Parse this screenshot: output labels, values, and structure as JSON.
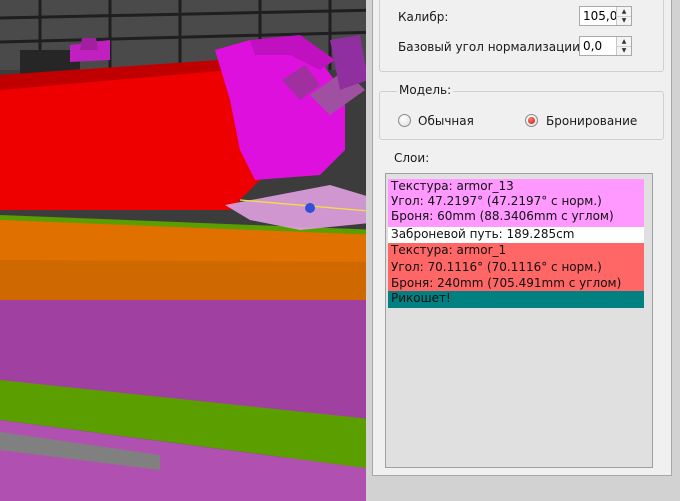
{
  "settings": {
    "caliber_label": "Калибр:",
    "caliber_value": "105,0",
    "normalization_label": "Базовый угол нормализации:",
    "normalization_value": "0,0"
  },
  "model": {
    "title": "Модель:",
    "options": [
      {
        "label": "Обычная",
        "selected": false
      },
      {
        "label": "Бронирование",
        "selected": true
      }
    ]
  },
  "layers": {
    "title": "Слои:",
    "lines": [
      {
        "text": "Текстура: armor_13",
        "color": "#ff99ff"
      },
      {
        "text": "Угол: 47.2197° (47.2197° с норм.)",
        "color": "#ff99ff"
      },
      {
        "text": "Броня: 60mm (88.3406mm с углом)",
        "color": "#ff99ff"
      },
      {
        "text": "Заброневой путь: 189.285cm",
        "color": "#ffffff"
      },
      {
        "text": "Текстура: armor_1",
        "color": "#ff6666"
      },
      {
        "text": "Угол: 70.1116° (70.1116° с норм.)",
        "color": "#ff6666"
      },
      {
        "text": "Броня: 240mm (705.491mm с углом)",
        "color": "#ff6666"
      },
      {
        "text": "Рикошет!",
        "color": "#008080"
      }
    ]
  }
}
